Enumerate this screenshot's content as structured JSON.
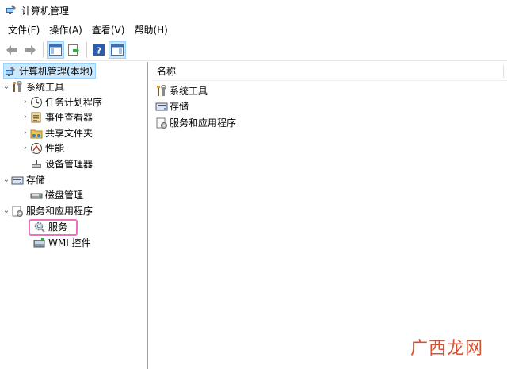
{
  "window": {
    "title": "计算机管理"
  },
  "menu": [
    "文件(F)",
    "操作(A)",
    "查看(V)",
    "帮助(H)"
  ],
  "tree": {
    "root": "计算机管理(本地)",
    "system_tools": "系统工具",
    "task_scheduler": "任务计划程序",
    "event_viewer": "事件查看器",
    "shared_folders": "共享文件夹",
    "performance": "性能",
    "device_manager": "设备管理器",
    "storage": "存储",
    "disk_management": "磁盘管理",
    "services_apps": "服务和应用程序",
    "services": "服务",
    "wmi_control": "WMI 控件"
  },
  "list": {
    "column_name": "名称",
    "items": [
      "系统工具",
      "存储",
      "服务和应用程序"
    ]
  },
  "watermark": "广西龙网",
  "colors": {
    "selection": "#cce8ff",
    "highlight_box": "#f06fbf",
    "watermark": "#d95030"
  }
}
